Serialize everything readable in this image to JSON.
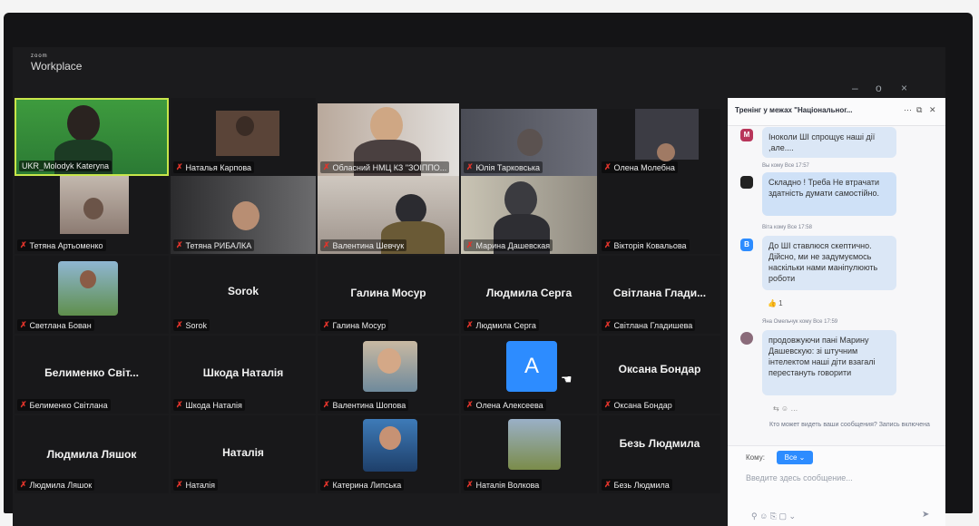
{
  "app": {
    "brand_small": "zoom",
    "brand": "Workplace"
  },
  "window_controls": {
    "minimize": "–",
    "maximize": "o",
    "close": "×"
  },
  "participants": [
    {
      "name": "UKR_Molodyk Kateryna",
      "video": true
    },
    {
      "name": "Наталья Карпова",
      "video": true
    },
    {
      "name": "Обласний НМЦ КЗ \"ЗОІППО...",
      "video": true
    },
    {
      "name": "Юлія Тарковська",
      "video": true
    },
    {
      "name": "Олена Молебна",
      "video": true
    },
    {
      "name": "Тетяна Артьоменко",
      "video": true
    },
    {
      "name": "Тетяна РИБАЛКА",
      "video": true
    },
    {
      "name": "Валентина Шевчук",
      "video": true
    },
    {
      "name": "Марина Дашевская",
      "video": true
    },
    {
      "name": "Вікторія Ковальова",
      "video": false
    },
    {
      "name": "Светлана Бован",
      "video": false,
      "photo": true
    },
    {
      "name": "Sorok",
      "display": "Sorok",
      "video": false
    },
    {
      "name": "Галина Мосур",
      "display": "Галина Мосур",
      "video": false
    },
    {
      "name": "Людмила Серга",
      "display": "Людмила Серга",
      "video": false
    },
    {
      "name": "Світлана Гладишева",
      "display": "Світлана Глади...",
      "video": false
    },
    {
      "name": "Белименко Світлана",
      "display": "Белименко Світ...",
      "video": false
    },
    {
      "name": "Шкода Наталія",
      "display": "Шкода Наталія",
      "video": false
    },
    {
      "name": "Валентина Шопова",
      "video": false,
      "photo": true
    },
    {
      "name": "Олена Алексеева",
      "video": false,
      "initial": "A"
    },
    {
      "name": "Оксана Бондар",
      "display": "Оксана Бондар",
      "video": false
    },
    {
      "name": "Людмила Ляшок",
      "display": "Людмила Ляшок",
      "video": false
    },
    {
      "name": "Наталія",
      "display": "Наталія",
      "video": false
    },
    {
      "name": "Катерина Липська",
      "video": false,
      "photo": true
    },
    {
      "name": "Наталія Волкова",
      "video": false,
      "photo": true
    },
    {
      "name": "Безь Людмила",
      "display": "Безь Людмила",
      "video": false
    }
  ],
  "chat": {
    "title": "Тренінг у межах \"Національног...",
    "messages": [
      {
        "avatar": "M",
        "text": "Іноколи ШІ спрощує наші дії ,але...."
      },
      {
        "meta": "Вы кому Все 17:57",
        "text": "Складно ! Треба Не втрачати здатність думати самостійно."
      },
      {
        "meta": "Віта кому Все 17:58",
        "avatar": "В",
        "text": "До ШІ ставлюся скептично. Дійсно, ми не задумуємось наскільки нами маніпулюють роботи",
        "reaction": "👍 1"
      },
      {
        "meta": "Яна Омельчук кому Все 17:59",
        "text": "продовжуючи пані Марину Дашевскую: зі штучним інтелектом наші діти взагалі перестануть говорити"
      }
    ],
    "visibility_note": "Кто может видеть ваши сообщения? Запись включена",
    "to_label": "Кому:",
    "to_value": "Все",
    "placeholder": "Введите здесь сообщение..."
  },
  "colors": {
    "accent": "#2d8cff",
    "mic_muted": "#e0342b",
    "active_speaker": "#c8e64a"
  }
}
